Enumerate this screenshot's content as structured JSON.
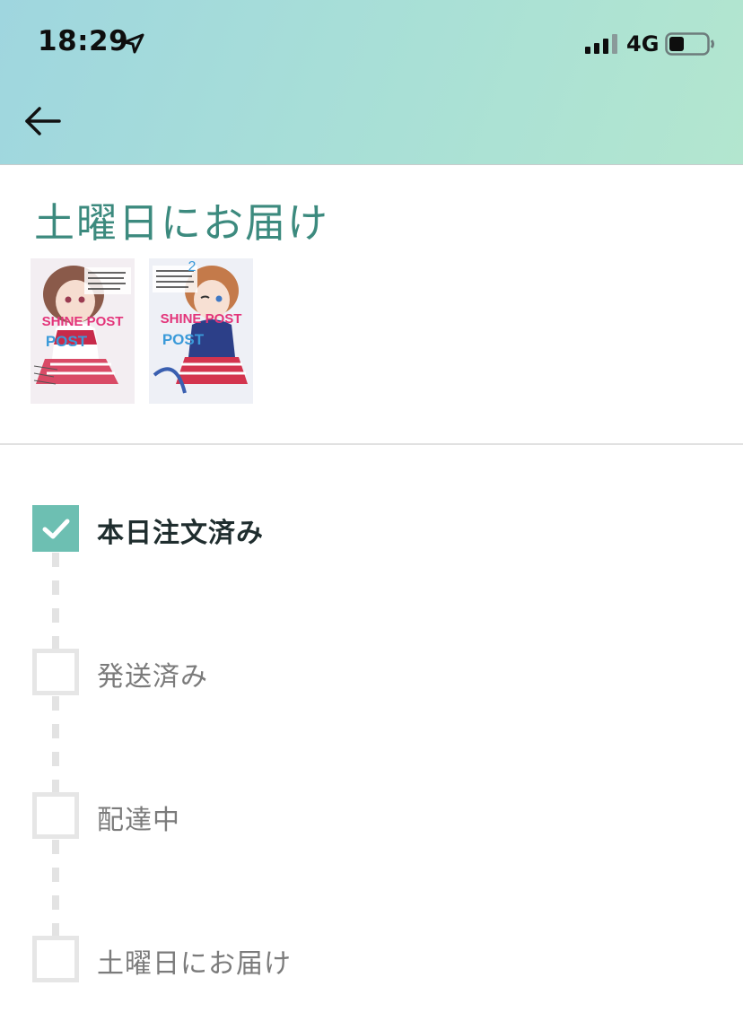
{
  "status_bar": {
    "time": "18:29",
    "network": "4G",
    "icons": [
      "location-arrow-icon",
      "signal-bars-icon",
      "battery-icon"
    ]
  },
  "nav": {
    "back_icon": "arrow-left-icon"
  },
  "page": {
    "title": "土曜日にお届け"
  },
  "items": [
    {
      "title_text": "SHINE POST",
      "badge": "",
      "name": "book-cover-1"
    },
    {
      "title_text": "SHINE POST",
      "badge": "2",
      "name": "book-cover-2"
    }
  ],
  "steps": [
    {
      "label": "本日注文済み",
      "done": true
    },
    {
      "label": "発送済み",
      "done": false
    },
    {
      "label": "配達中",
      "done": false
    },
    {
      "label": "土曜日にお届け",
      "done": false
    }
  ],
  "colors": {
    "accent": "#6dbfb2",
    "title": "#3c8a7e",
    "header_gradient_start": "#9fd6df",
    "header_gradient_end": "#b3e6cf"
  }
}
